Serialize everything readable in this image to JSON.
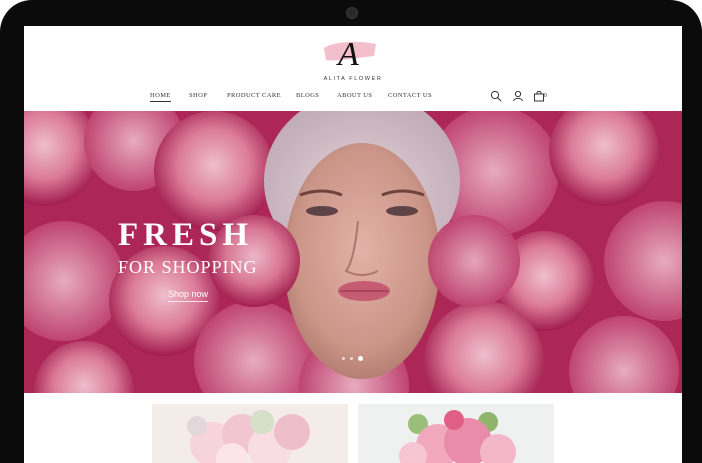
{
  "brand": {
    "name": "ALITA FLOWER",
    "mark_letter": "A",
    "mark_color": "#f2b8c6"
  },
  "nav": {
    "items": [
      {
        "label": "HOME",
        "active": true
      },
      {
        "label": "SHOP"
      },
      {
        "label": "PRODUCT CARE"
      },
      {
        "label": "BLOGS"
      },
      {
        "label": "ABOUT US"
      },
      {
        "label": "CONTACT US"
      }
    ],
    "icons": [
      "search-icon",
      "user-icon",
      "bag-icon"
    ],
    "cart_count": "0"
  },
  "hero": {
    "title": "FRESH",
    "subtitle": "FOR SHOPPING",
    "cta": "Shop now",
    "slides": 3,
    "active_slide": 3
  },
  "colors": {
    "accent_pink": "#f2b8c6",
    "hero_bg": "#b32a5a",
    "text_dark": "#333333"
  }
}
